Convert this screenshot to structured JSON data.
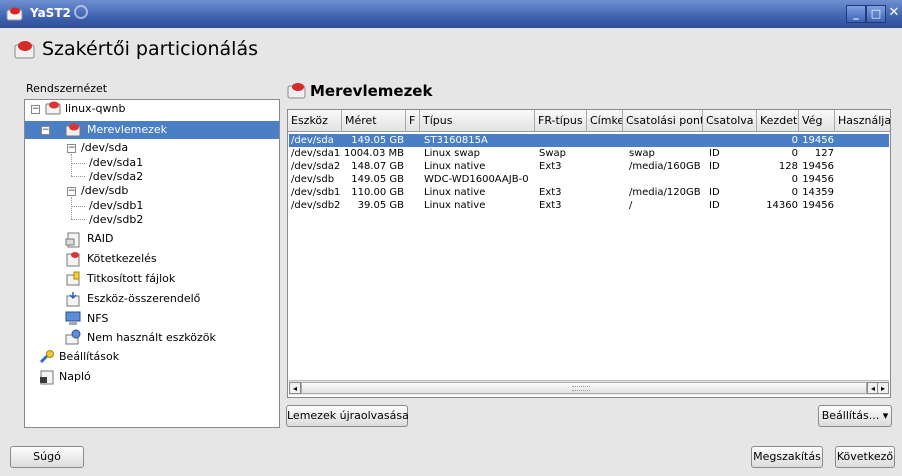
{
  "window": {
    "title": "YaST2"
  },
  "header": {
    "title": "Szakértői particionálás"
  },
  "system_view_label": "Rendszernézet",
  "tree": [
    {
      "label": "linux-qwnb",
      "icon": "computer-icon"
    },
    {
      "label": "Merevlemezek",
      "icon": "harddisk-icon",
      "selected": true
    },
    {
      "label": "/dev/sda"
    },
    {
      "label": "/dev/sda1"
    },
    {
      "label": "/dev/sda2"
    },
    {
      "label": "/dev/sdb"
    },
    {
      "label": "/dev/sdb1"
    },
    {
      "label": "/dev/sdb2"
    },
    {
      "label": "RAID",
      "icon": "raid-icon"
    },
    {
      "label": "Kötetkezelés",
      "icon": "volume-management-icon"
    },
    {
      "label": "Titkosított fájlok",
      "icon": "encrypted-files-icon"
    },
    {
      "label": "Eszköz-összerendelő",
      "icon": "device-mapper-icon"
    },
    {
      "label": "NFS",
      "icon": "nfs-icon"
    },
    {
      "label": "Nem használt eszközök",
      "icon": "unused-devices-icon"
    },
    {
      "label": "Beállítások",
      "icon": "settings-icon"
    },
    {
      "label": "Napló",
      "icon": "log-icon"
    }
  ],
  "main": {
    "title": "Merevlemezek",
    "columns": [
      "Eszköz",
      "Méret",
      "F",
      "Típus",
      "FR-típus",
      "Címke",
      "Csatolási pont",
      "Csatolva",
      "Kezdet",
      "Vég",
      "Használja"
    ],
    "rows": [
      {
        "cells": [
          "/dev/sda",
          "149.05 GB",
          "",
          "ST3160815A",
          "",
          "",
          "",
          "",
          "0",
          "19456",
          ""
        ],
        "selected": true
      },
      {
        "cells": [
          "/dev/sda1",
          "1004.03 MB",
          "",
          "Linux swap",
          "Swap",
          "",
          "swap",
          "ID",
          "0",
          "127",
          ""
        ]
      },
      {
        "cells": [
          "/dev/sda2",
          "148.07 GB",
          "",
          "Linux native",
          "Ext3",
          "",
          "/media/160GB",
          "ID",
          "128",
          "19456",
          ""
        ]
      },
      {
        "cells": [
          "/dev/sdb",
          "149.05 GB",
          "",
          "WDC-WD1600AAJB-0",
          "",
          "",
          "",
          "",
          "0",
          "19456",
          ""
        ]
      },
      {
        "cells": [
          "/dev/sdb1",
          "110.00 GB",
          "",
          "Linux native",
          "Ext3",
          "",
          "/media/120GB",
          "ID",
          "0",
          "14359",
          ""
        ]
      },
      {
        "cells": [
          "/dev/sdb2",
          "39.05 GB",
          "",
          "Linux native",
          "Ext3",
          "",
          "/",
          "ID",
          "14360",
          "19456",
          ""
        ]
      }
    ]
  },
  "buttons": {
    "rescan": "Lemezek újraolvasása",
    "settings": "Beállítás...",
    "help": "Súgó",
    "abort": "Megszakítás",
    "next": "Következő"
  },
  "colors": {
    "selection": "#4a7fc6",
    "titlebar": "#3f63b0"
  }
}
